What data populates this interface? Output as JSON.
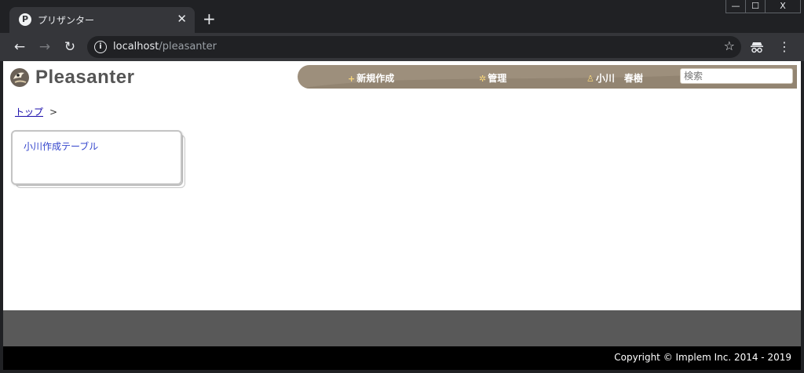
{
  "browser": {
    "tab": {
      "favicon_letter": "P",
      "title": "プリザンター",
      "close_glyph": "✕"
    },
    "new_tab_glyph": "+",
    "window": {
      "minimize": "—",
      "maximize": "☐",
      "close": "X"
    },
    "nav": {
      "back": "←",
      "forward": "→",
      "reload": "↻"
    },
    "omnibox": {
      "info_glyph": "i",
      "host": "localhost",
      "path": "/pleasanter",
      "star": "☆"
    },
    "incognito_icon": "incognito-icon",
    "menu_glyph": "⋮"
  },
  "app": {
    "logo_text": "Pleasanter",
    "nav": [
      {
        "icon": "+",
        "label": "新規作成"
      },
      {
        "icon": "✲",
        "label": "管理"
      },
      {
        "icon": "♙",
        "label": "小川　春樹"
      }
    ],
    "search_placeholder": "検索",
    "breadcrumb": {
      "top": "トップ",
      "separator": ">"
    },
    "cards": [
      {
        "title": "小川作成テーブル"
      }
    ],
    "copyright": "Copyright © Implem Inc. 2014 - 2019"
  },
  "colors": {
    "navbar": "#9d8f7c",
    "footer": "#595959",
    "card_link": "#3344cc"
  }
}
